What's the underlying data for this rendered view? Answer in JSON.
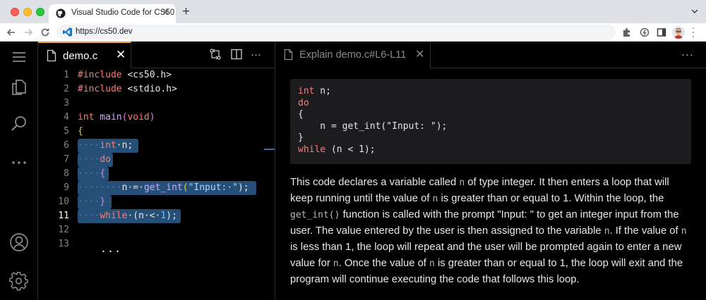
{
  "browser": {
    "tab_title": "Visual Studio Code for CS50",
    "tab_close": "✕",
    "new_tab": "+",
    "url": "https://cs50.dev",
    "colors": {
      "tabbar": "#dee1e6",
      "red": "#fe5f57",
      "yellow": "#febc2e",
      "green": "#28c840"
    }
  },
  "activity_bar": {
    "icons": [
      "menu-icon",
      "explorer-icon",
      "search-icon",
      "more-icon",
      "account-icon",
      "settings-icon"
    ]
  },
  "editor": {
    "tab_title": "demo.c",
    "tab_close": "✕",
    "toolbar_icons": [
      "compare-changes-icon",
      "split-editor-icon",
      "more-actions-icon"
    ],
    "more_label": "···",
    "line_numbers": [
      "1",
      "2",
      "3",
      "4",
      "5",
      "6",
      "7",
      "8",
      "9",
      "10",
      "11",
      "12",
      "13"
    ],
    "active_line": "11",
    "folded_marker": "...",
    "lines": {
      "l1_kw": "#include",
      "l1_rest": " <cs50.h>",
      "l2_kw": "#include",
      "l2_rest": " <stdio.h>",
      "l4_type": "int",
      "l4_fn": "main",
      "l4_paren_open": "(",
      "l4_void": "void",
      "l4_paren_close": ")",
      "l5": "{",
      "l6_dots": "····",
      "l6_type": "int",
      "l6_rest": "·n;",
      "l7_dots": "····",
      "l7_kw": "do",
      "l8_dots": "····",
      "l8_brace": "{",
      "l9_dots": "········",
      "l9_a": "n·=·",
      "l9_fn": "get_int",
      "l9_p1": "(",
      "l9_str": "\"Input:·\"",
      "l9_p2": ");",
      "l10_dots": "····",
      "l10_brace": "}",
      "l11_dots": "····",
      "l11_kw": "while",
      "l11_a": "·(n·<·",
      "l11_num": "1",
      "l11_b": ");"
    },
    "colors": {
      "selection": "#264f78",
      "tab_accent": "#f0a33a",
      "keyword": "#ff7b72",
      "function": "#d2a8ff",
      "string": "#a5d6ff"
    }
  },
  "explain": {
    "tab_title": "Explain demo.c#L6-L11",
    "tab_close": "✕",
    "more_label": "···",
    "snippet": {
      "s1_type": "int",
      "s1_rest": " n;",
      "s2_kw": "do",
      "s3": "{",
      "s4_a": "    n = ",
      "s4_fn": "get_int",
      "s4_p1": "(",
      "s4_str": "\"Input: \"",
      "s4_p2": ");",
      "s5": "}",
      "s6_kw": "while",
      "s6_a": " (n < ",
      "s6_num": "1",
      "s6_b": ");"
    },
    "text": {
      "t1": "This code declares a variable called ",
      "c1": "n",
      "t2": " of type integer. It then enters a loop that will keep running until the value of ",
      "c2": "n",
      "t3": " is greater than or equal to 1. Within the loop, the ",
      "c3": "get_int()",
      "t4": " function is called with the prompt \"Input: \" to get an integer input from the user. The value entered by the user is then assigned to the variable ",
      "c4": "n",
      "t5": ". If the value of ",
      "c5": "n",
      "t6": " is less than 1, the loop will repeat and the user will be prompted again to enter a new value for ",
      "c6": "n",
      "t7": ". Once the value of ",
      "c7": "n",
      "t8": " is greater than or equal to 1, the loop will exit and the program will continue executing the code that follows this loop."
    }
  }
}
